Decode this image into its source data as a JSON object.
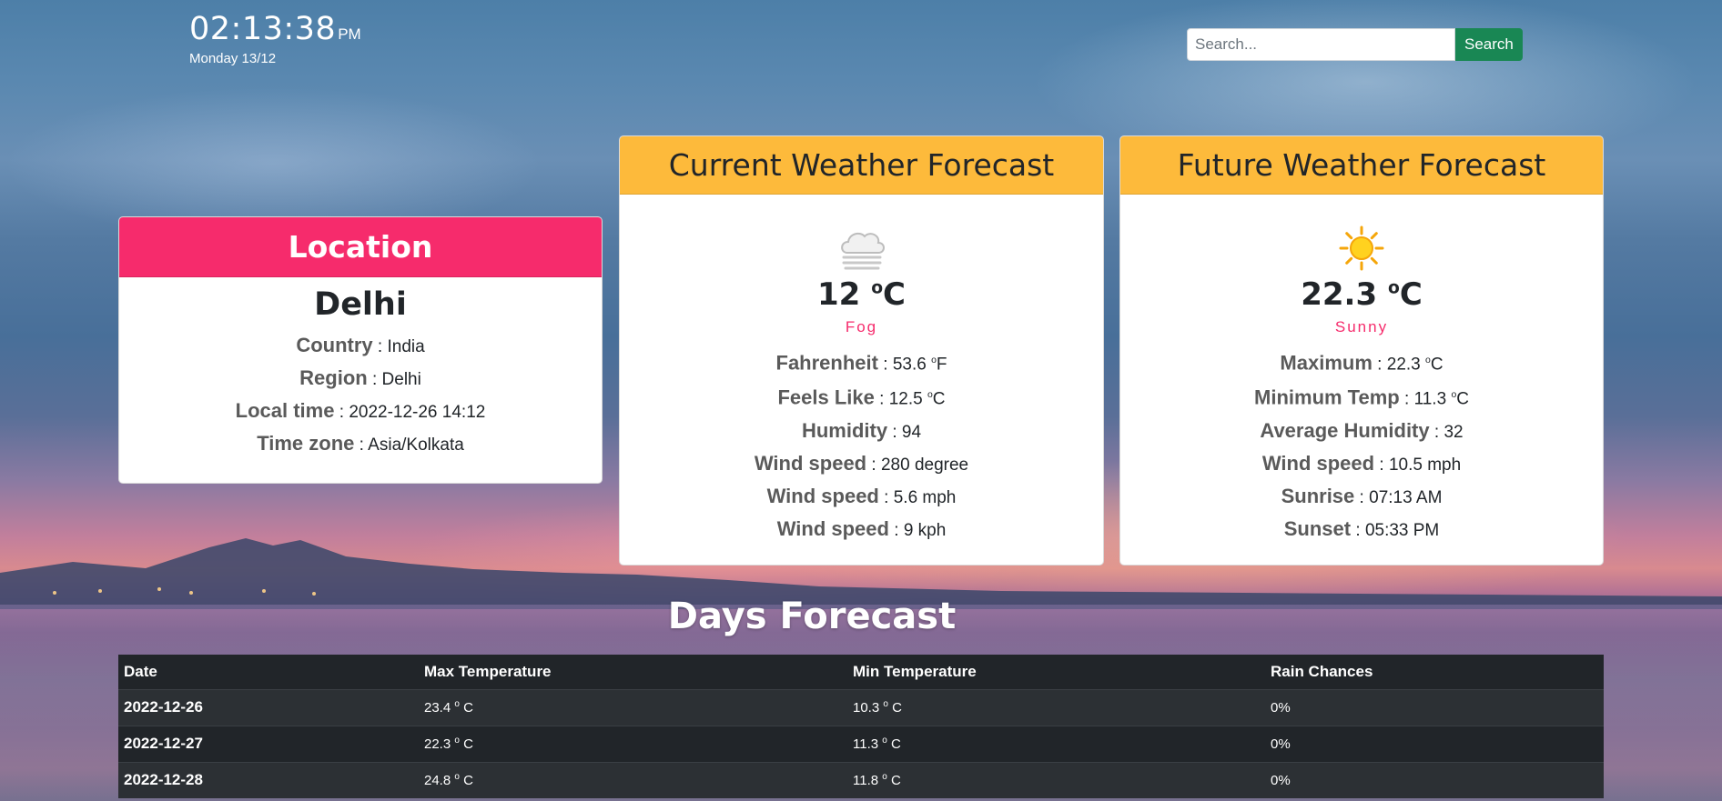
{
  "clock": {
    "time": "02:13:38",
    "ampm": "PM",
    "date": "Monday 13/12"
  },
  "search": {
    "placeholder": "Search...",
    "button": "Search"
  },
  "location": {
    "title": "Location",
    "city": "Delhi",
    "rows": [
      {
        "label": "Country",
        "value": "India"
      },
      {
        "label": "Region",
        "value": "Delhi"
      },
      {
        "label": "Local time",
        "value": "2022-12-26 14:12"
      },
      {
        "label": "Time zone",
        "value": "Asia/Kolkata"
      }
    ]
  },
  "current": {
    "title": "Current Weather Forecast",
    "icon": "fog-icon",
    "temp": "12",
    "temp_unit": "C",
    "condition": "Fog",
    "rows": [
      {
        "label": "Fahrenheit",
        "value": "53.6",
        "unit": "F"
      },
      {
        "label": "Feels Like",
        "value": "12.5",
        "unit": "C"
      },
      {
        "label": "Humidity",
        "value": "94"
      },
      {
        "label": "Wind speed",
        "value": "280 degree"
      },
      {
        "label": "Wind speed",
        "value": "5.6 mph"
      },
      {
        "label": "Wind speed",
        "value": "9 kph"
      }
    ]
  },
  "future": {
    "title": "Future Weather Forecast",
    "icon": "sun-icon",
    "temp": "22.3",
    "temp_unit": "C",
    "condition": "Sunny",
    "rows": [
      {
        "label": "Maximum",
        "value": "22.3",
        "unit": "C"
      },
      {
        "label": "Minimum Temp",
        "value": "11.3",
        "unit": "C"
      },
      {
        "label": "Average Humidity",
        "value": "32"
      },
      {
        "label": "Wind speed",
        "value": "10.5 mph"
      },
      {
        "label": "Sunrise",
        "value": "07:13 AM"
      },
      {
        "label": "Sunset",
        "value": "05:33 PM"
      }
    ]
  },
  "days": {
    "title": "Days Forecast",
    "headers": [
      "Date",
      "Max Temperature",
      "Min Temperature",
      "Rain Chances"
    ],
    "rows": [
      [
        "2022-12-26",
        "23.4",
        "10.3",
        "0%"
      ],
      [
        "2022-12-27",
        "22.3",
        "11.3",
        "0%"
      ],
      [
        "2022-12-28",
        "24.8",
        "11.8",
        "0%"
      ]
    ],
    "temp_unit": "C"
  },
  "colors": {
    "location_header": "#f62b6c",
    "forecast_header": "#fdba3b",
    "search_button": "#198754",
    "condition": "#f62b6c"
  }
}
